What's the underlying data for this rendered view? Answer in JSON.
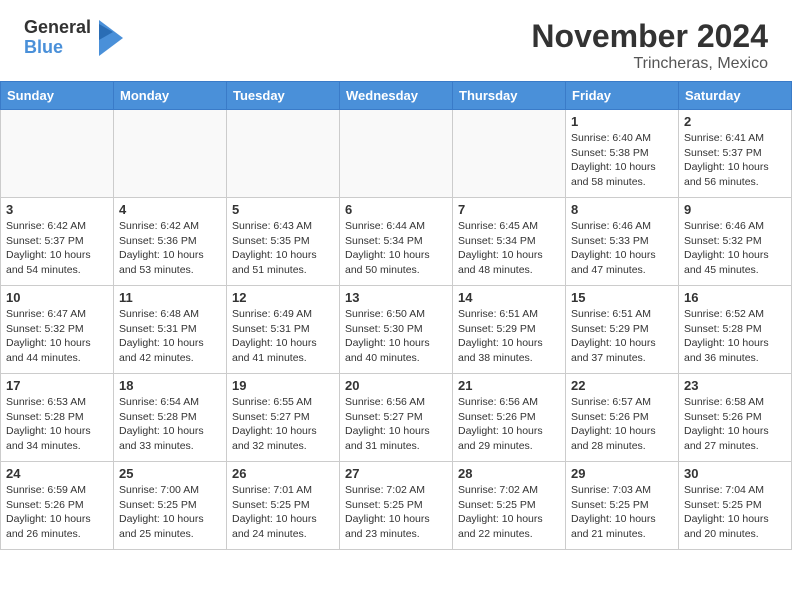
{
  "header": {
    "logo_general": "General",
    "logo_blue": "Blue",
    "month_title": "November 2024",
    "location": "Trincheras, Mexico"
  },
  "days_of_week": [
    "Sunday",
    "Monday",
    "Tuesday",
    "Wednesday",
    "Thursday",
    "Friday",
    "Saturday"
  ],
  "weeks": [
    [
      {
        "day": "",
        "info": ""
      },
      {
        "day": "",
        "info": ""
      },
      {
        "day": "",
        "info": ""
      },
      {
        "day": "",
        "info": ""
      },
      {
        "day": "",
        "info": ""
      },
      {
        "day": "1",
        "info": "Sunrise: 6:40 AM\nSunset: 5:38 PM\nDaylight: 10 hours and 58 minutes."
      },
      {
        "day": "2",
        "info": "Sunrise: 6:41 AM\nSunset: 5:37 PM\nDaylight: 10 hours and 56 minutes."
      }
    ],
    [
      {
        "day": "3",
        "info": "Sunrise: 6:42 AM\nSunset: 5:37 PM\nDaylight: 10 hours and 54 minutes."
      },
      {
        "day": "4",
        "info": "Sunrise: 6:42 AM\nSunset: 5:36 PM\nDaylight: 10 hours and 53 minutes."
      },
      {
        "day": "5",
        "info": "Sunrise: 6:43 AM\nSunset: 5:35 PM\nDaylight: 10 hours and 51 minutes."
      },
      {
        "day": "6",
        "info": "Sunrise: 6:44 AM\nSunset: 5:34 PM\nDaylight: 10 hours and 50 minutes."
      },
      {
        "day": "7",
        "info": "Sunrise: 6:45 AM\nSunset: 5:34 PM\nDaylight: 10 hours and 48 minutes."
      },
      {
        "day": "8",
        "info": "Sunrise: 6:46 AM\nSunset: 5:33 PM\nDaylight: 10 hours and 47 minutes."
      },
      {
        "day": "9",
        "info": "Sunrise: 6:46 AM\nSunset: 5:32 PM\nDaylight: 10 hours and 45 minutes."
      }
    ],
    [
      {
        "day": "10",
        "info": "Sunrise: 6:47 AM\nSunset: 5:32 PM\nDaylight: 10 hours and 44 minutes."
      },
      {
        "day": "11",
        "info": "Sunrise: 6:48 AM\nSunset: 5:31 PM\nDaylight: 10 hours and 42 minutes."
      },
      {
        "day": "12",
        "info": "Sunrise: 6:49 AM\nSunset: 5:31 PM\nDaylight: 10 hours and 41 minutes."
      },
      {
        "day": "13",
        "info": "Sunrise: 6:50 AM\nSunset: 5:30 PM\nDaylight: 10 hours and 40 minutes."
      },
      {
        "day": "14",
        "info": "Sunrise: 6:51 AM\nSunset: 5:29 PM\nDaylight: 10 hours and 38 minutes."
      },
      {
        "day": "15",
        "info": "Sunrise: 6:51 AM\nSunset: 5:29 PM\nDaylight: 10 hours and 37 minutes."
      },
      {
        "day": "16",
        "info": "Sunrise: 6:52 AM\nSunset: 5:28 PM\nDaylight: 10 hours and 36 minutes."
      }
    ],
    [
      {
        "day": "17",
        "info": "Sunrise: 6:53 AM\nSunset: 5:28 PM\nDaylight: 10 hours and 34 minutes."
      },
      {
        "day": "18",
        "info": "Sunrise: 6:54 AM\nSunset: 5:28 PM\nDaylight: 10 hours and 33 minutes."
      },
      {
        "day": "19",
        "info": "Sunrise: 6:55 AM\nSunset: 5:27 PM\nDaylight: 10 hours and 32 minutes."
      },
      {
        "day": "20",
        "info": "Sunrise: 6:56 AM\nSunset: 5:27 PM\nDaylight: 10 hours and 31 minutes."
      },
      {
        "day": "21",
        "info": "Sunrise: 6:56 AM\nSunset: 5:26 PM\nDaylight: 10 hours and 29 minutes."
      },
      {
        "day": "22",
        "info": "Sunrise: 6:57 AM\nSunset: 5:26 PM\nDaylight: 10 hours and 28 minutes."
      },
      {
        "day": "23",
        "info": "Sunrise: 6:58 AM\nSunset: 5:26 PM\nDaylight: 10 hours and 27 minutes."
      }
    ],
    [
      {
        "day": "24",
        "info": "Sunrise: 6:59 AM\nSunset: 5:26 PM\nDaylight: 10 hours and 26 minutes."
      },
      {
        "day": "25",
        "info": "Sunrise: 7:00 AM\nSunset: 5:25 PM\nDaylight: 10 hours and 25 minutes."
      },
      {
        "day": "26",
        "info": "Sunrise: 7:01 AM\nSunset: 5:25 PM\nDaylight: 10 hours and 24 minutes."
      },
      {
        "day": "27",
        "info": "Sunrise: 7:02 AM\nSunset: 5:25 PM\nDaylight: 10 hours and 23 minutes."
      },
      {
        "day": "28",
        "info": "Sunrise: 7:02 AM\nSunset: 5:25 PM\nDaylight: 10 hours and 22 minutes."
      },
      {
        "day": "29",
        "info": "Sunrise: 7:03 AM\nSunset: 5:25 PM\nDaylight: 10 hours and 21 minutes."
      },
      {
        "day": "30",
        "info": "Sunrise: 7:04 AM\nSunset: 5:25 PM\nDaylight: 10 hours and 20 minutes."
      }
    ]
  ]
}
